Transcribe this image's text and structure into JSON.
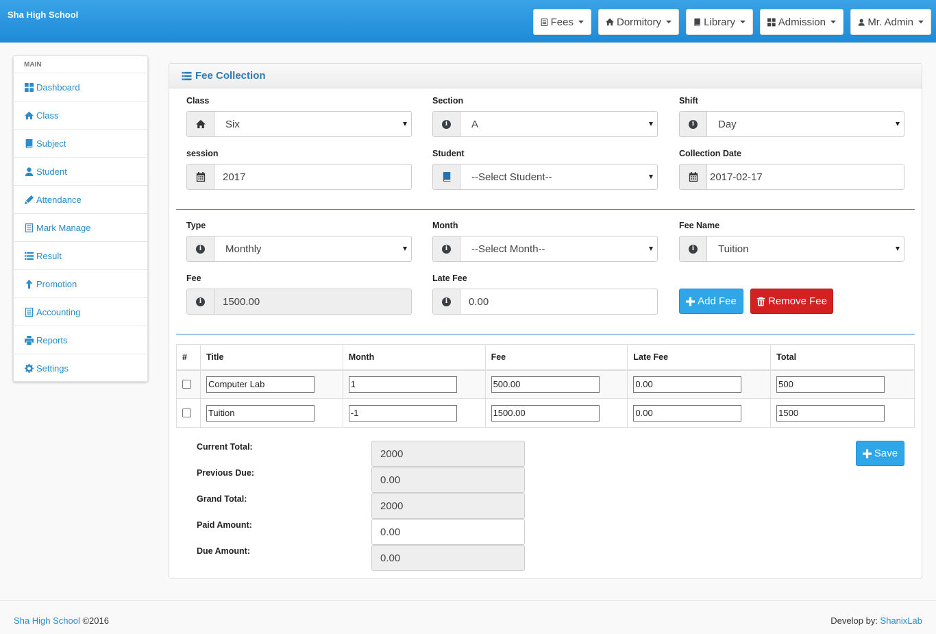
{
  "header": {
    "brand": "Sha High School",
    "nav": [
      {
        "label": "Fees",
        "icon": "list-icon"
      },
      {
        "label": "Dormitory",
        "icon": "home-icon"
      },
      {
        "label": "Library",
        "icon": "book-icon"
      },
      {
        "label": "Admission",
        "icon": "th-large-icon"
      },
      {
        "label": "Mr. Admin",
        "icon": "user-icon"
      }
    ]
  },
  "sidebar": {
    "heading": "MAIN",
    "items": [
      {
        "label": "Dashboard",
        "icon": "th-large-icon"
      },
      {
        "label": "Class",
        "icon": "home-icon"
      },
      {
        "label": "Subject",
        "icon": "book-icon"
      },
      {
        "label": "Student",
        "icon": "user-icon"
      },
      {
        "label": "Attendance",
        "icon": "pencil-icon"
      },
      {
        "label": "Mark Manage",
        "icon": "list-alt-icon"
      },
      {
        "label": "Result",
        "icon": "list-icon"
      },
      {
        "label": "Promotion",
        "icon": "arrow-up-icon"
      },
      {
        "label": "Accounting",
        "icon": "list-alt-icon"
      },
      {
        "label": "Reports",
        "icon": "print-icon"
      },
      {
        "label": "Settings",
        "icon": "cog-icon"
      }
    ]
  },
  "panel": {
    "title": "Fee Collection",
    "form": {
      "class": {
        "label": "Class",
        "value": "Six"
      },
      "section": {
        "label": "Section",
        "value": "A"
      },
      "shift": {
        "label": "Shift",
        "value": "Day"
      },
      "session": {
        "label": "session",
        "value": "2017"
      },
      "student": {
        "label": "Student",
        "value": "--Select Student--"
      },
      "collection_date": {
        "label": "Collection Date",
        "value": "2017-02-17"
      },
      "type": {
        "label": "Type",
        "value": "Monthly"
      },
      "month": {
        "label": "Month",
        "value": "--Select Month--"
      },
      "fee_name": {
        "label": "Fee Name",
        "value": "Tuition"
      },
      "fee": {
        "label": "Fee",
        "value": "1500.00"
      },
      "late_fee": {
        "label": "Late Fee",
        "value": "0.00"
      }
    },
    "buttons": {
      "add_fee": "Add Fee",
      "remove_fee": "Remove Fee",
      "save": "Save"
    },
    "table": {
      "headers": [
        "#",
        "Title",
        "Month",
        "Fee",
        "Late Fee",
        "Total"
      ],
      "rows": [
        {
          "title": "Computer Lab",
          "month": "1",
          "fee": "500.00",
          "late_fee": "0.00",
          "total": "500"
        },
        {
          "title": "Tuition",
          "month": "-1",
          "fee": "1500.00",
          "late_fee": "0.00",
          "total": "1500"
        }
      ]
    },
    "summary": {
      "current_total": {
        "label": "Current Total:",
        "value": "2000"
      },
      "previous_due": {
        "label": "Previous Due:",
        "value": "0.00"
      },
      "grand_total": {
        "label": "Grand Total:",
        "value": "2000"
      },
      "paid_amount": {
        "label": "Paid Amount:",
        "value": "0.00"
      },
      "due_amount": {
        "label": "Due Amount:",
        "value": "0.00"
      }
    }
  },
  "footer": {
    "left_link": "Sha High School",
    "left_text": " ©2016",
    "right_text": "Develop by: ",
    "right_link": "ShanixLab"
  },
  "colors": {
    "header_blue": "#2196e0",
    "link_blue": "#2a8ccb",
    "add_blue": "#2ea6e8",
    "remove_red": "#d32121"
  }
}
